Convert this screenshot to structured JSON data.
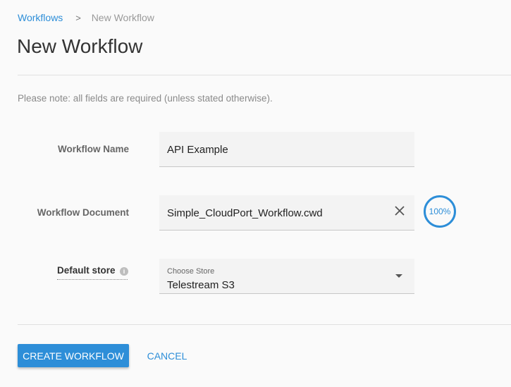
{
  "breadcrumb": {
    "parent": "Workflows",
    "separator": ">",
    "current": "New Workflow"
  },
  "page": {
    "title": "New Workflow",
    "note": "Please note: all fields are required (unless stated otherwise)."
  },
  "form": {
    "workflow_name": {
      "label": "Workflow Name",
      "value": "API Example"
    },
    "workflow_document": {
      "label": "Workflow Document",
      "value": "Simple_CloudPort_Workflow.cwd",
      "upload_progress": "100%"
    },
    "default_store": {
      "label": "Default store",
      "caption": "Choose Store",
      "value": "Telestream S3"
    }
  },
  "actions": {
    "create": "CREATE WORKFLOW",
    "cancel": "CANCEL"
  },
  "colors": {
    "accent": "#2d8ed8"
  },
  "icons": {
    "clear": "close-icon",
    "info": "info-icon",
    "dropdown": "chevron-down-icon"
  }
}
